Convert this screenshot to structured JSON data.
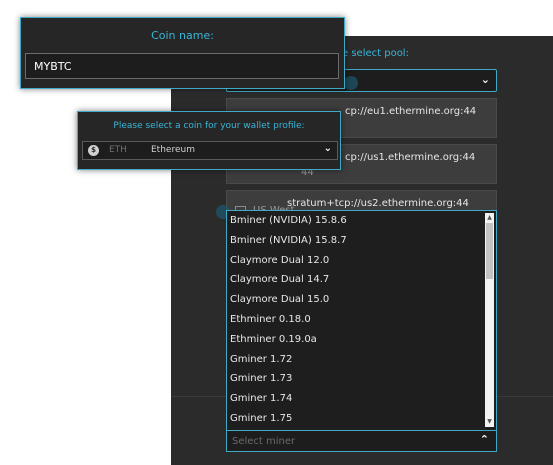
{
  "pool_section": {
    "label": "e select pool:",
    "rows": [
      {
        "url": "cp://eu1.ethermine.org:44",
        "suffix": ""
      },
      {
        "url": "cp://us1.ethermine.org:44",
        "suffix": "44"
      },
      {
        "url": "stratum+tcp://us2.ethermine.org:44",
        "name": "US West"
      }
    ]
  },
  "coin_panel": {
    "title": "Coin name:",
    "value": "MYBTC"
  },
  "wallet_panel": {
    "title": "Please select a coin for your wallet profile:",
    "coin_ticker": "ETH",
    "coin_name": "Ethereum",
    "coin_icon": "$"
  },
  "miner_dropdown": {
    "items": [
      "Bminer (NVIDIA) 15.8.6",
      "Bminer (NVIDIA) 15.8.7",
      "Claymore Dual 12.0",
      "Claymore Dual 14.7",
      "Claymore Dual 15.0",
      "Ethminer 0.18.0",
      "Ethminer 0.19.0a",
      "Gminer 1.72",
      "Gminer 1.73",
      "Gminer 1.74",
      "Gminer 1.75"
    ],
    "placeholder": "Select miner"
  },
  "colors": {
    "accent": "#3fa9c6",
    "panel_bg": "#262626",
    "page_bg": "#2b2b2b"
  }
}
